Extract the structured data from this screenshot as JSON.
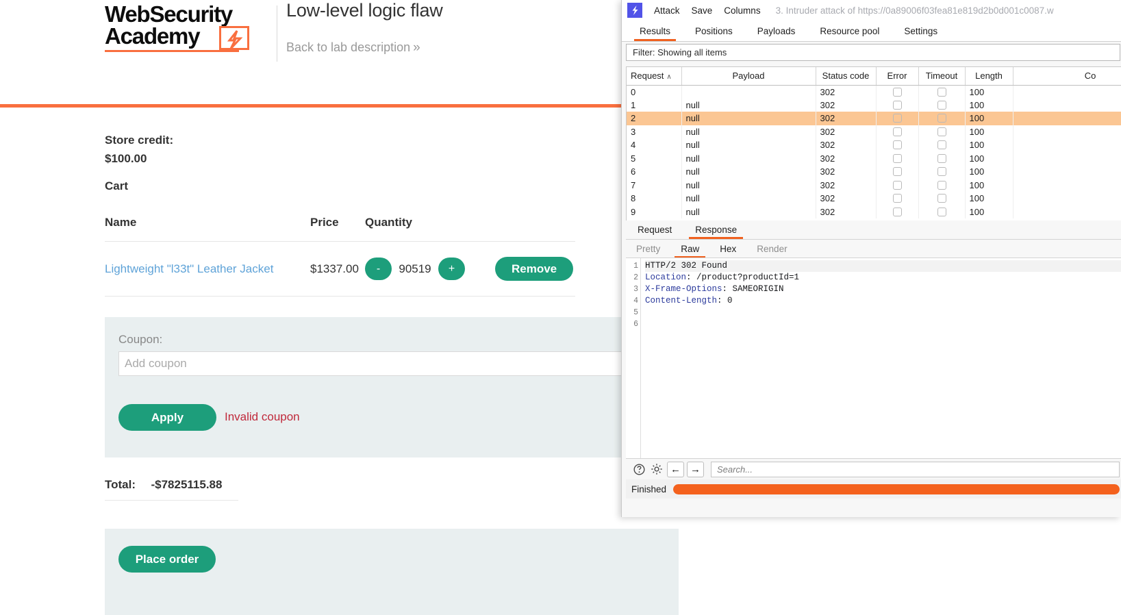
{
  "lab": {
    "logo_line1": "WebSecurity",
    "logo_line2": "Academy",
    "logo_bolt_icon": "lightning-bolt-icon",
    "title": "Low-level logic flaw",
    "back_link": "Back to lab description",
    "back_chevron": "»",
    "accent_color": "#f96f3f",
    "brand_green": "#1d9e7b",
    "store_credit_label": "Store credit:",
    "store_credit_value": "$100.00",
    "cart_heading": "Cart",
    "table_headers": {
      "name": "Name",
      "price": "Price",
      "quantity": "Quantity",
      "action": ""
    },
    "cart_rows": [
      {
        "name": "Lightweight \"l33t\" Leather Jacket",
        "price": "$1337.00",
        "decrement": "-",
        "quantity": "90519",
        "increment": "+",
        "remove": "Remove"
      }
    ],
    "coupon": {
      "label": "Coupon:",
      "placeholder": "Add coupon",
      "value": "",
      "apply_label": "Apply",
      "error": "Invalid coupon",
      "error_color": "#c0293b"
    },
    "total_label": "Total:",
    "total_value": "-$7825115.88",
    "place_order_label": "Place order"
  },
  "burp": {
    "app_icon": "burp-lightning-icon",
    "menu": [
      "Attack",
      "Save",
      "Columns"
    ],
    "attack_title": "3. Intruder attack of https://0a89006f03fea81e819d2b0d001c0087.w",
    "tabs": [
      {
        "label": "Results",
        "active": true
      },
      {
        "label": "Positions",
        "active": false
      },
      {
        "label": "Payloads",
        "active": false
      },
      {
        "label": "Resource pool",
        "active": false
      },
      {
        "label": "Settings",
        "active": false
      }
    ],
    "filter_text": "Filter: Showing all items",
    "results": {
      "columns": [
        "Request",
        "Payload",
        "Status code",
        "Error",
        "Timeout",
        "Length",
        "Co"
      ],
      "sort_column": "Request",
      "sort_direction": "ascending",
      "sort_glyph": "∧",
      "selected_row_index": 2,
      "selected_row_color": "#fbc693",
      "rows": [
        {
          "request": "0",
          "payload": "",
          "status": "302",
          "error": false,
          "timeout": false,
          "length": "100",
          "comment": ""
        },
        {
          "request": "1",
          "payload": "null",
          "status": "302",
          "error": false,
          "timeout": false,
          "length": "100",
          "comment": ""
        },
        {
          "request": "2",
          "payload": "null",
          "status": "302",
          "error": false,
          "timeout": false,
          "length": "100",
          "comment": ""
        },
        {
          "request": "3",
          "payload": "null",
          "status": "302",
          "error": false,
          "timeout": false,
          "length": "100",
          "comment": ""
        },
        {
          "request": "4",
          "payload": "null",
          "status": "302",
          "error": false,
          "timeout": false,
          "length": "100",
          "comment": ""
        },
        {
          "request": "5",
          "payload": "null",
          "status": "302",
          "error": false,
          "timeout": false,
          "length": "100",
          "comment": ""
        },
        {
          "request": "6",
          "payload": "null",
          "status": "302",
          "error": false,
          "timeout": false,
          "length": "100",
          "comment": ""
        },
        {
          "request": "7",
          "payload": "null",
          "status": "302",
          "error": false,
          "timeout": false,
          "length": "100",
          "comment": ""
        },
        {
          "request": "8",
          "payload": "null",
          "status": "302",
          "error": false,
          "timeout": false,
          "length": "100",
          "comment": ""
        },
        {
          "request": "9",
          "payload": "null",
          "status": "302",
          "error": false,
          "timeout": false,
          "length": "100",
          "comment": ""
        }
      ]
    },
    "message_tabs": [
      {
        "label": "Request",
        "active": false
      },
      {
        "label": "Response",
        "active": true
      }
    ],
    "view_tabs": [
      {
        "label": "Pretty",
        "active": false,
        "enabled": false
      },
      {
        "label": "Raw",
        "active": true,
        "enabled": true
      },
      {
        "label": "Hex",
        "active": false,
        "enabled": true
      },
      {
        "label": "Render",
        "active": false,
        "enabled": false
      }
    ],
    "response_lines": [
      {
        "no": "1",
        "key": "",
        "text": "HTTP/2 302 Found"
      },
      {
        "no": "2",
        "key": "Location",
        "text": ": /product?productId=1"
      },
      {
        "no": "3",
        "key": "X-Frame-Options",
        "text": ": SAMEORIGIN"
      },
      {
        "no": "4",
        "key": "Content-Length",
        "text": ": 0"
      },
      {
        "no": "5",
        "key": "",
        "text": ""
      },
      {
        "no": "6",
        "key": "",
        "text": ""
      }
    ],
    "bottom_toolbar": {
      "help_icon": "question-mark-circle-icon",
      "settings_icon": "gear-icon",
      "back_icon": "arrow-left-icon",
      "forward_icon": "arrow-right-icon",
      "search_placeholder": "Search...",
      "search_value": ""
    },
    "status": {
      "text": "Finished",
      "progress_percent": 100,
      "progress_color": "#f4611d"
    }
  }
}
